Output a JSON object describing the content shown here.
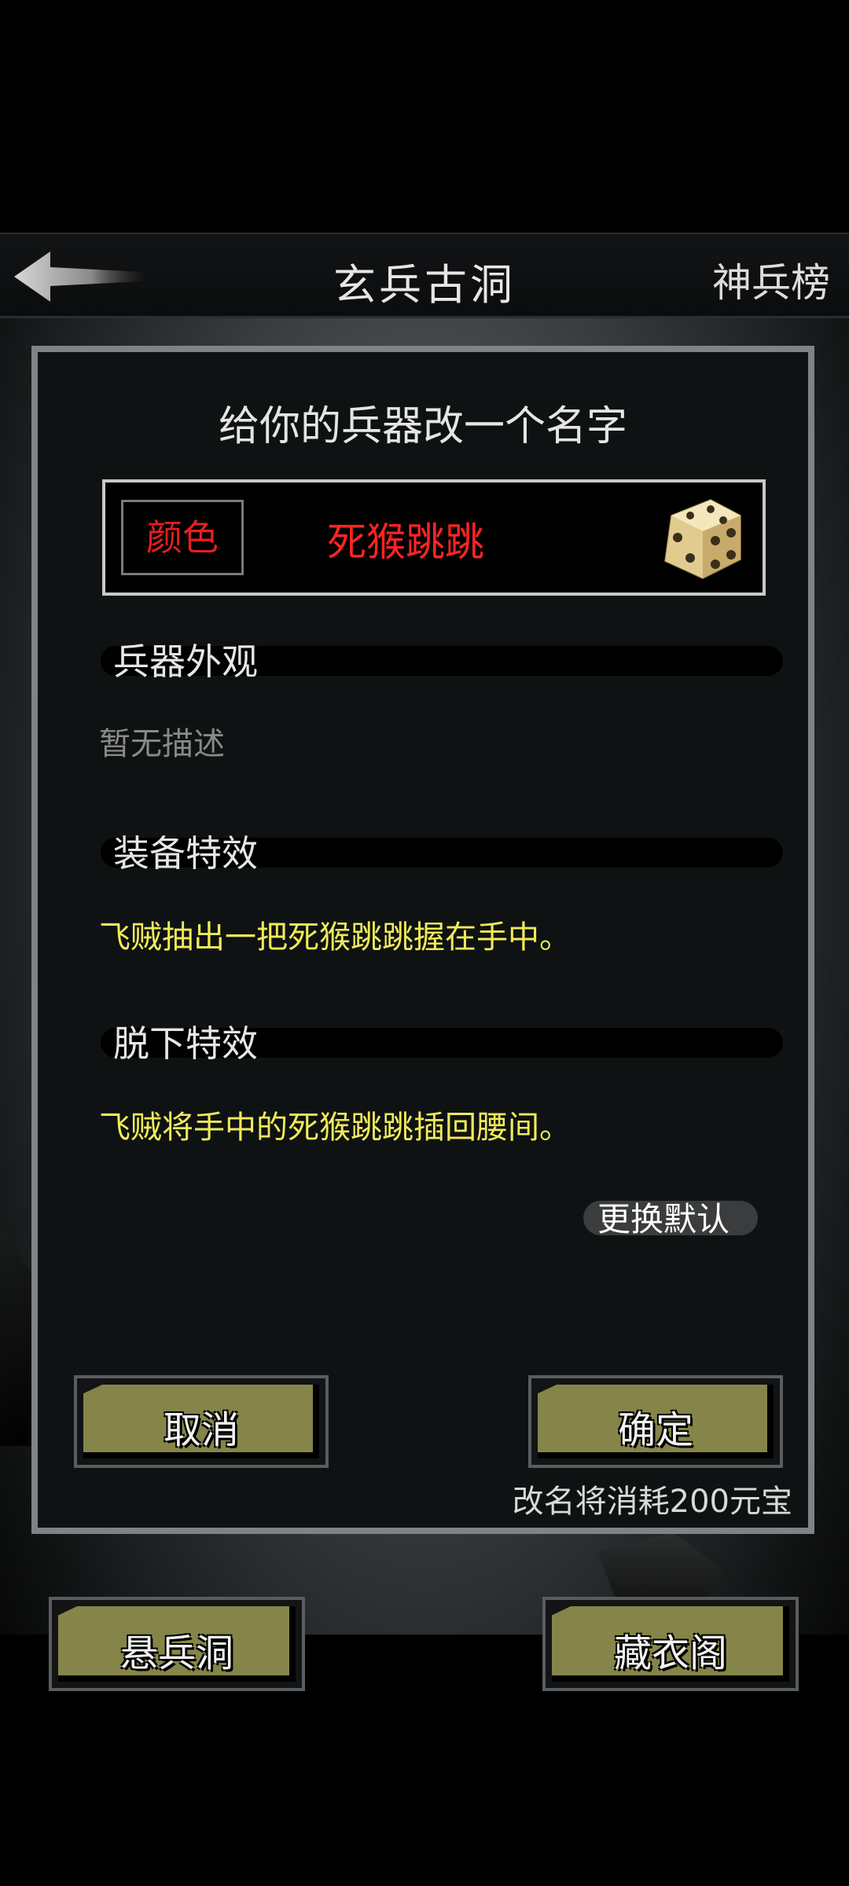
{
  "header": {
    "title": "玄兵古洞",
    "right_link": "神兵榜",
    "back_icon": "back-arrow-icon"
  },
  "dialog": {
    "title": "给你的兵器改一个名字",
    "color_button": "颜色",
    "weapon_name": "死猴跳跳",
    "name_color": "#ff2424",
    "dice_icon": "dice-icon",
    "sections": [
      {
        "label": "兵器外观",
        "text": "暂无描述"
      },
      {
        "label": "装备特效",
        "text": "飞贼抽出一把死猴跳跳握在手中。"
      },
      {
        "label": "脱下特效",
        "text": "飞贼将手中的死猴跳跳插回腰间。"
      }
    ],
    "change_default": "更换默认",
    "cancel": "取消",
    "confirm": "确定",
    "cost_note": "改名将消耗200元宝"
  },
  "footer": {
    "left_button": "悬兵洞",
    "right_button": "藏衣阁"
  },
  "colors": {
    "accent_olive": "#85854a",
    "effect_text": "#f0ea58"
  }
}
